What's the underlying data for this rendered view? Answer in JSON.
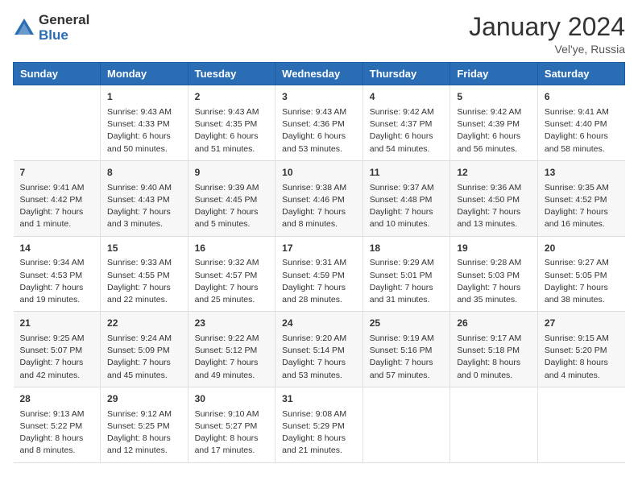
{
  "logo": {
    "general": "General",
    "blue": "Blue"
  },
  "title": "January 2024",
  "location": "Vel'ye, Russia",
  "days_header": [
    "Sunday",
    "Monday",
    "Tuesday",
    "Wednesday",
    "Thursday",
    "Friday",
    "Saturday"
  ],
  "weeks": [
    [
      {
        "day": "",
        "info": ""
      },
      {
        "day": "1",
        "info": "Sunrise: 9:43 AM\nSunset: 4:33 PM\nDaylight: 6 hours\nand 50 minutes."
      },
      {
        "day": "2",
        "info": "Sunrise: 9:43 AM\nSunset: 4:35 PM\nDaylight: 6 hours\nand 51 minutes."
      },
      {
        "day": "3",
        "info": "Sunrise: 9:43 AM\nSunset: 4:36 PM\nDaylight: 6 hours\nand 53 minutes."
      },
      {
        "day": "4",
        "info": "Sunrise: 9:42 AM\nSunset: 4:37 PM\nDaylight: 6 hours\nand 54 minutes."
      },
      {
        "day": "5",
        "info": "Sunrise: 9:42 AM\nSunset: 4:39 PM\nDaylight: 6 hours\nand 56 minutes."
      },
      {
        "day": "6",
        "info": "Sunrise: 9:41 AM\nSunset: 4:40 PM\nDaylight: 6 hours\nand 58 minutes."
      }
    ],
    [
      {
        "day": "7",
        "info": "Sunrise: 9:41 AM\nSunset: 4:42 PM\nDaylight: 7 hours\nand 1 minute."
      },
      {
        "day": "8",
        "info": "Sunrise: 9:40 AM\nSunset: 4:43 PM\nDaylight: 7 hours\nand 3 minutes."
      },
      {
        "day": "9",
        "info": "Sunrise: 9:39 AM\nSunset: 4:45 PM\nDaylight: 7 hours\nand 5 minutes."
      },
      {
        "day": "10",
        "info": "Sunrise: 9:38 AM\nSunset: 4:46 PM\nDaylight: 7 hours\nand 8 minutes."
      },
      {
        "day": "11",
        "info": "Sunrise: 9:37 AM\nSunset: 4:48 PM\nDaylight: 7 hours\nand 10 minutes."
      },
      {
        "day": "12",
        "info": "Sunrise: 9:36 AM\nSunset: 4:50 PM\nDaylight: 7 hours\nand 13 minutes."
      },
      {
        "day": "13",
        "info": "Sunrise: 9:35 AM\nSunset: 4:52 PM\nDaylight: 7 hours\nand 16 minutes."
      }
    ],
    [
      {
        "day": "14",
        "info": "Sunrise: 9:34 AM\nSunset: 4:53 PM\nDaylight: 7 hours\nand 19 minutes."
      },
      {
        "day": "15",
        "info": "Sunrise: 9:33 AM\nSunset: 4:55 PM\nDaylight: 7 hours\nand 22 minutes."
      },
      {
        "day": "16",
        "info": "Sunrise: 9:32 AM\nSunset: 4:57 PM\nDaylight: 7 hours\nand 25 minutes."
      },
      {
        "day": "17",
        "info": "Sunrise: 9:31 AM\nSunset: 4:59 PM\nDaylight: 7 hours\nand 28 minutes."
      },
      {
        "day": "18",
        "info": "Sunrise: 9:29 AM\nSunset: 5:01 PM\nDaylight: 7 hours\nand 31 minutes."
      },
      {
        "day": "19",
        "info": "Sunrise: 9:28 AM\nSunset: 5:03 PM\nDaylight: 7 hours\nand 35 minutes."
      },
      {
        "day": "20",
        "info": "Sunrise: 9:27 AM\nSunset: 5:05 PM\nDaylight: 7 hours\nand 38 minutes."
      }
    ],
    [
      {
        "day": "21",
        "info": "Sunrise: 9:25 AM\nSunset: 5:07 PM\nDaylight: 7 hours\nand 42 minutes."
      },
      {
        "day": "22",
        "info": "Sunrise: 9:24 AM\nSunset: 5:09 PM\nDaylight: 7 hours\nand 45 minutes."
      },
      {
        "day": "23",
        "info": "Sunrise: 9:22 AM\nSunset: 5:12 PM\nDaylight: 7 hours\nand 49 minutes."
      },
      {
        "day": "24",
        "info": "Sunrise: 9:20 AM\nSunset: 5:14 PM\nDaylight: 7 hours\nand 53 minutes."
      },
      {
        "day": "25",
        "info": "Sunrise: 9:19 AM\nSunset: 5:16 PM\nDaylight: 7 hours\nand 57 minutes."
      },
      {
        "day": "26",
        "info": "Sunrise: 9:17 AM\nSunset: 5:18 PM\nDaylight: 8 hours\nand 0 minutes."
      },
      {
        "day": "27",
        "info": "Sunrise: 9:15 AM\nSunset: 5:20 PM\nDaylight: 8 hours\nand 4 minutes."
      }
    ],
    [
      {
        "day": "28",
        "info": "Sunrise: 9:13 AM\nSunset: 5:22 PM\nDaylight: 8 hours\nand 8 minutes."
      },
      {
        "day": "29",
        "info": "Sunrise: 9:12 AM\nSunset: 5:25 PM\nDaylight: 8 hours\nand 12 minutes."
      },
      {
        "day": "30",
        "info": "Sunrise: 9:10 AM\nSunset: 5:27 PM\nDaylight: 8 hours\nand 17 minutes."
      },
      {
        "day": "31",
        "info": "Sunrise: 9:08 AM\nSunset: 5:29 PM\nDaylight: 8 hours\nand 21 minutes."
      },
      {
        "day": "",
        "info": ""
      },
      {
        "day": "",
        "info": ""
      },
      {
        "day": "",
        "info": ""
      }
    ]
  ]
}
